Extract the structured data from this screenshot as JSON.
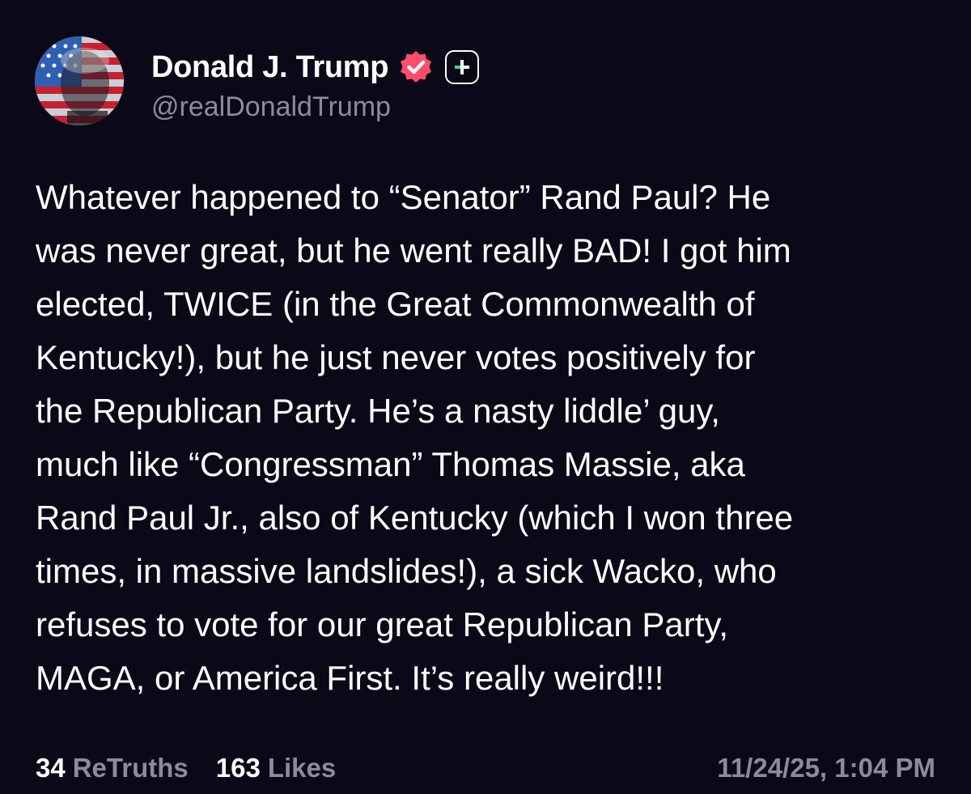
{
  "post": {
    "author": {
      "display_name": "Donald J. Trump",
      "handle": "@realDonaldTrump",
      "verified_icon": "verified-badge-icon",
      "verified_color": "#ff4d6d",
      "plus_icon": "plus-badge-icon",
      "plus_accent_color": "#3ed9a0"
    },
    "body_lines": [
      "Whatever happened to “Senator” Rand Paul? He",
      "was never great, but he went really BAD! I got him",
      "elected, TWICE (in the Great Commonwealth of",
      "Kentucky!), but he just never votes positively for",
      "the Republican Party. He’s a nasty liddle’ guy,",
      "much like “Congressman” Thomas Massie, aka",
      "Rand Paul Jr., also of Kentucky (which I won three",
      "times, in massive landslides!), a sick Wacko, who",
      "refuses to vote for our great Republican Party,",
      "MAGA, or America First. It’s really weird!!!"
    ],
    "stats": {
      "retruths_count": "34",
      "retruths_label": "ReTruths",
      "likes_count": "163",
      "likes_label": "Likes"
    },
    "timestamp": "11/24/25, 1:04 PM"
  },
  "colors": {
    "background": "#0b0918",
    "text_primary": "#ffffff",
    "text_secondary": "#8c8a9c"
  }
}
